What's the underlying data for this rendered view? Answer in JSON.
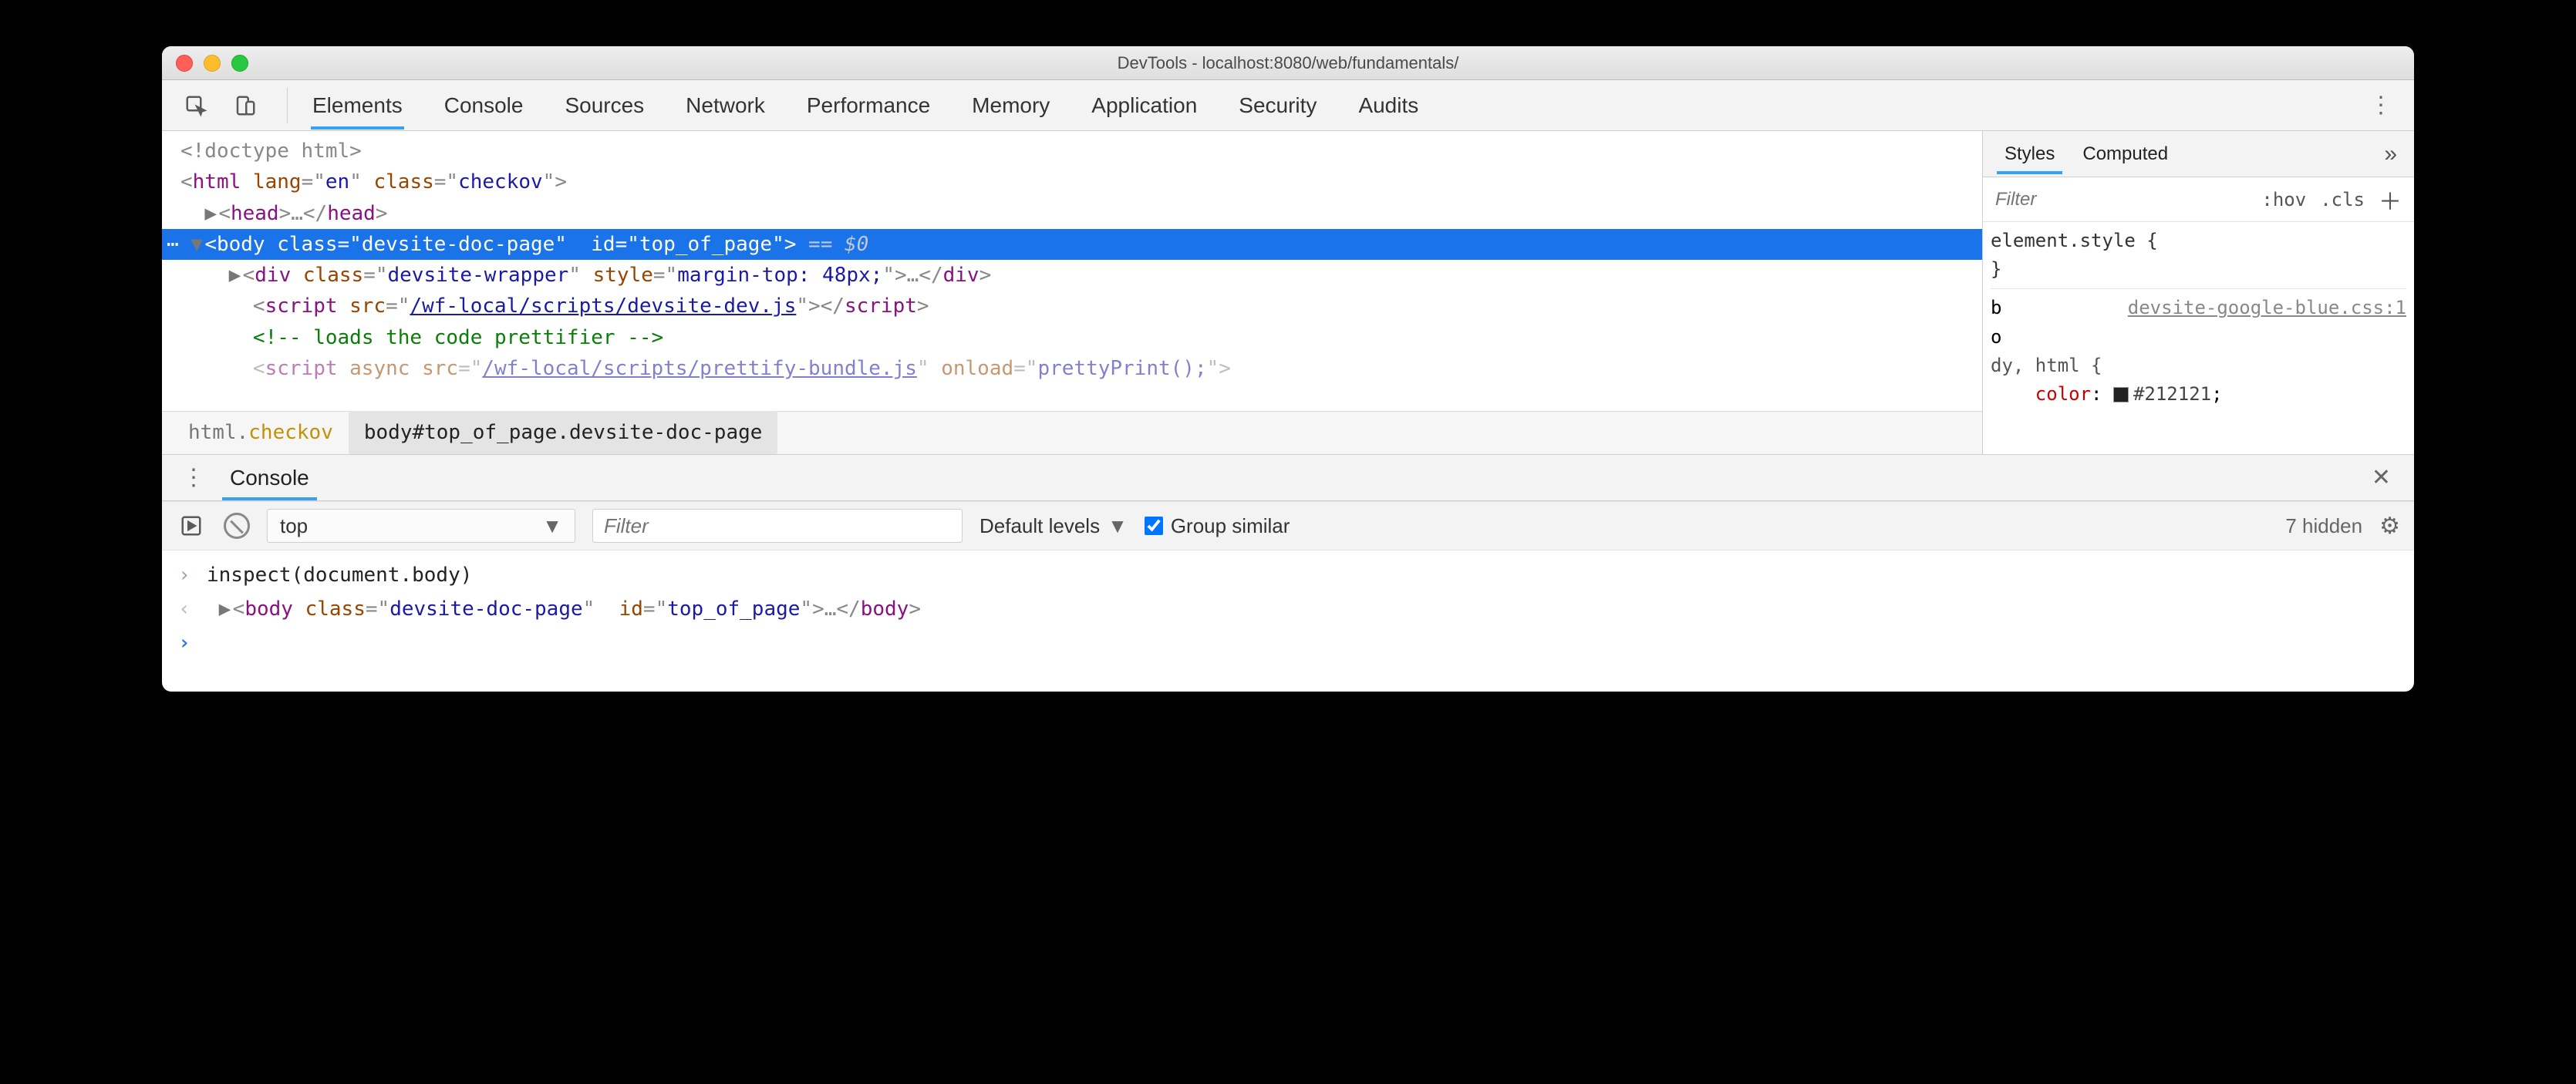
{
  "window": {
    "title": "DevTools - localhost:8080/web/fundamentals/"
  },
  "tabs": {
    "items": [
      "Elements",
      "Console",
      "Sources",
      "Network",
      "Performance",
      "Memory",
      "Application",
      "Security",
      "Audits"
    ],
    "active": 0
  },
  "dom": {
    "doctype": "<!doctype html>",
    "html_open": {
      "lang": "en",
      "class": "checkov"
    },
    "head_collapsed": "…",
    "body_sel": {
      "class": "devsite-doc-page",
      "id": "top_of_page",
      "trailer": " == $0"
    },
    "wrapper": {
      "class": "devsite-wrapper",
      "style": "margin-top: 48px;",
      "collapsed": "…"
    },
    "script1_src": "/wf-local/scripts/devsite-dev.js",
    "comment": " loads the code prettifier ",
    "script2": {
      "src": "/wf-local/scripts/prettify-bundle.js",
      "onload": "prettyPrint();"
    }
  },
  "crumbs": {
    "c0": {
      "tag": "html",
      "cls": "checkov"
    },
    "c1": "body#top_of_page.devsite-doc-page"
  },
  "styles": {
    "tabs": [
      "Styles",
      "Computed"
    ],
    "active": 0,
    "filter_ph": "Filter",
    "hov": ":hov",
    "cls": ".cls",
    "element_style": "element.style {",
    "brace_close": "}",
    "src": "devsite-google-blue.css:1",
    "b": "b",
    "o": "o",
    "sel": "dy, html {",
    "prop": "color",
    "val": "#212121",
    "semi": ";"
  },
  "drawer": {
    "tab": "Console"
  },
  "console_tb": {
    "context": "top",
    "filter_ph": "Filter",
    "levels": "Default levels",
    "group": "Group similar",
    "hidden": "7 hidden"
  },
  "console": {
    "in": "inspect(document.body)",
    "out": {
      "class": "devsite-doc-page",
      "id": "top_of_page",
      "collapsed": "…"
    }
  }
}
